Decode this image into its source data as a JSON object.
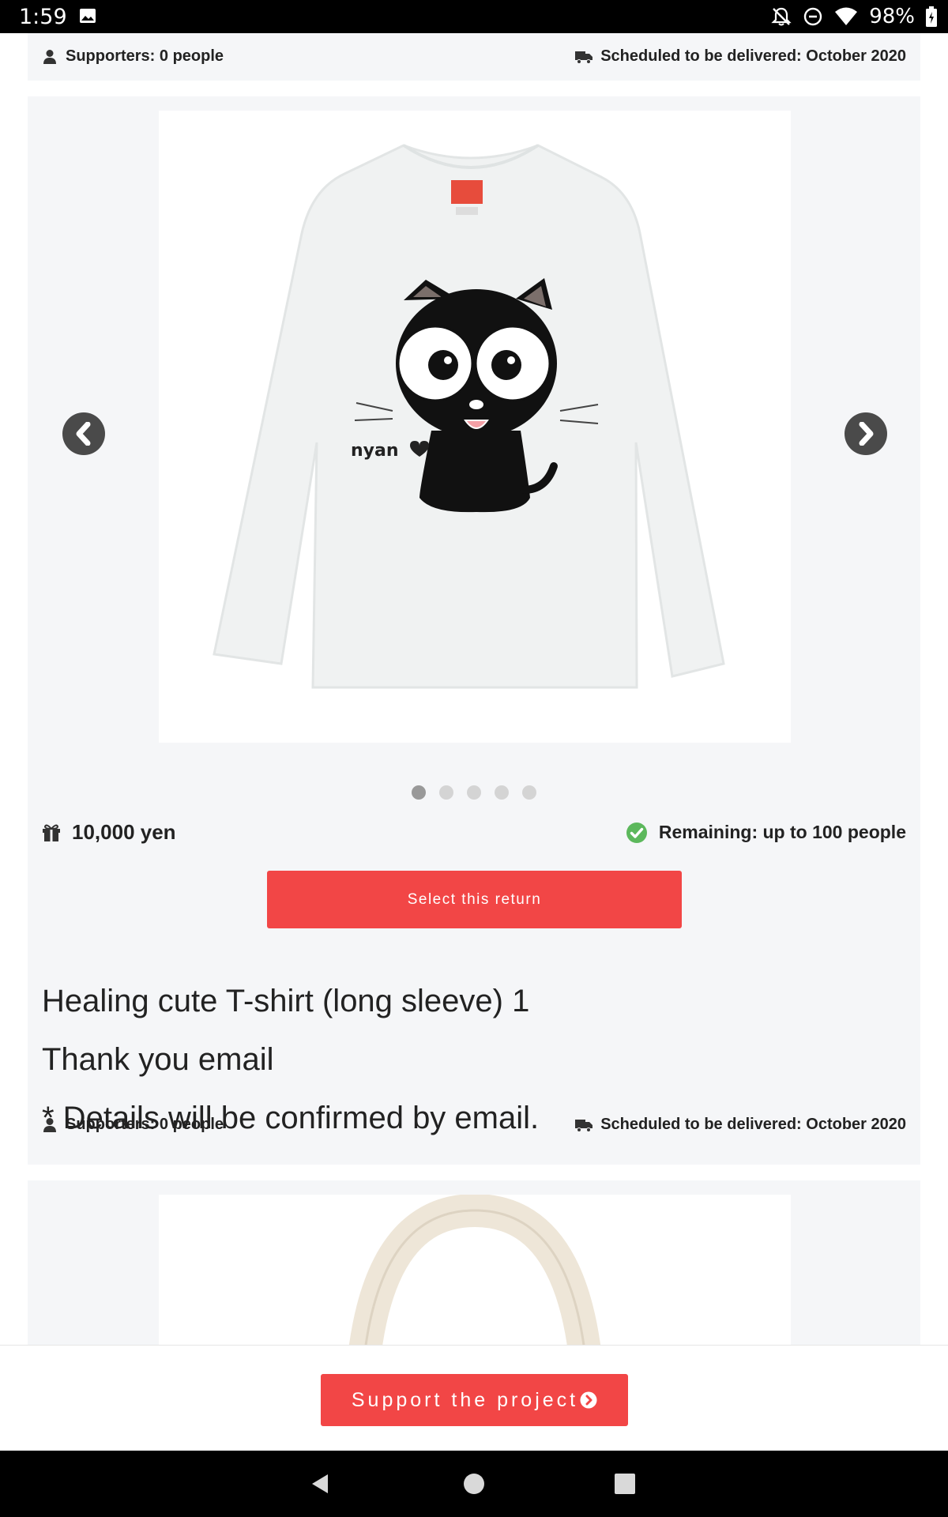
{
  "status_bar": {
    "time": "1:59",
    "battery": "98%",
    "icons": [
      "image-icon",
      "notifications-off-icon",
      "do-not-disturb-icon",
      "wifi-icon",
      "battery-icon"
    ]
  },
  "previous_card": {
    "supporters": "Supporters: 0 people",
    "delivery": "Scheduled to be delivered: October 2020"
  },
  "reward": {
    "carousel": {
      "image": "long-sleeve-tshirt-cat-print",
      "shirt_print_text": "nyan",
      "slide_count": 5,
      "active_slide": 1
    },
    "price": "10,000 yen",
    "remaining": "Remaining: up to 100 people",
    "select_label": "Select this return",
    "description": [
      "Healing cute T-shirt (long sleeve) 1",
      "Thank you email",
      "* Details will be confirmed by email."
    ],
    "supporters": "Supporters: 0 people",
    "delivery": "Scheduled to be delivered: October 2020"
  },
  "next_card": {
    "image": "canvas-tote-bag"
  },
  "bottom_bar": {
    "support_label": "Support the project"
  },
  "colors": {
    "accent": "#f24646",
    "check": "#5cb85c",
    "card_bg": "#f5f6f8"
  }
}
